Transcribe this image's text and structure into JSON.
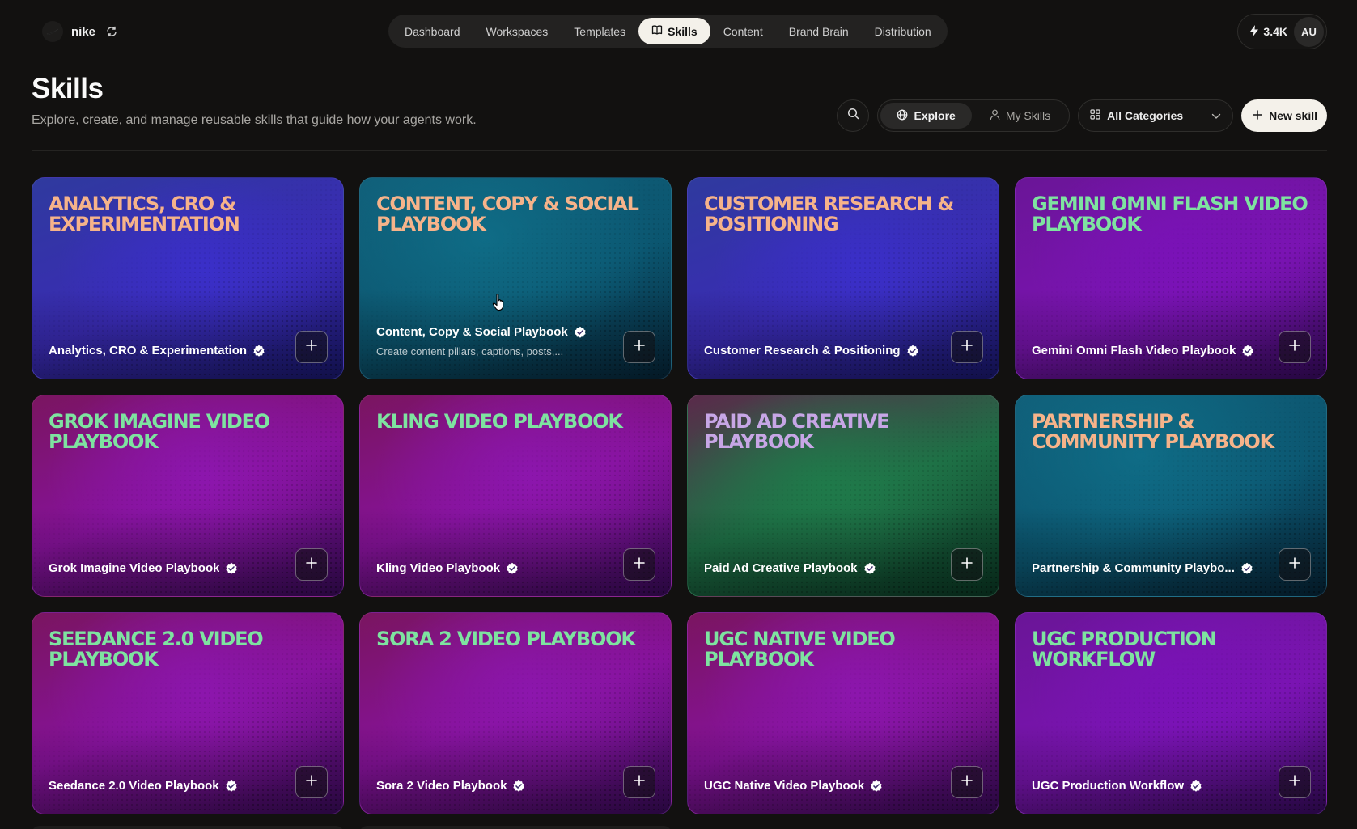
{
  "workspace": {
    "name": "nike"
  },
  "nav": {
    "items": [
      {
        "label": "Dashboard",
        "active": false
      },
      {
        "label": "Workspaces",
        "active": false
      },
      {
        "label": "Templates",
        "active": false
      },
      {
        "label": "Skills",
        "active": true
      },
      {
        "label": "Content",
        "active": false
      },
      {
        "label": "Brand Brain",
        "active": false
      },
      {
        "label": "Distribution",
        "active": false
      }
    ]
  },
  "account": {
    "credits": "3.4K",
    "initials": "AU"
  },
  "header": {
    "title": "Skills",
    "subtitle": "Explore, create, and manage reusable skills that guide how your agents work."
  },
  "controls": {
    "tabs": [
      {
        "label": "Explore",
        "icon": "globe-icon",
        "active": true
      },
      {
        "label": "My Skills",
        "icon": "user-icon",
        "active": false
      }
    ],
    "category_label": "All Categories",
    "new_skill_label": "New skill"
  },
  "colors": {
    "title_peach": "#f6b38a",
    "title_mint": "#7ee3a0",
    "title_lavender": "#c7a6e6",
    "accent_light": "#f4f1ea"
  },
  "skills": [
    {
      "title": "ANALYTICS, CRO & EXPERIMENTATION",
      "name": "Analytics, CRO & Experimentation",
      "description": "",
      "verified": true
    },
    {
      "title": "CONTENT, COPY & SOCIAL PLAYBOOK",
      "name": "Content, Copy & Social Playbook",
      "description": "Create content pillars, captions, posts,...",
      "verified": true
    },
    {
      "title": "CUSTOMER RESEARCH & POSITIONING",
      "name": "Customer Research & Positioning",
      "description": "",
      "verified": true
    },
    {
      "title": "GEMINI OMNI FLASH VIDEO PLAYBOOK",
      "name": "Gemini Omni Flash Video Playbook",
      "description": "",
      "verified": true
    },
    {
      "title": "GROK IMAGINE VIDEO PLAYBOOK",
      "name": "Grok Imagine Video Playbook",
      "description": "",
      "verified": true
    },
    {
      "title": "KLING VIDEO PLAYBOOK",
      "name": "Kling Video Playbook",
      "description": "",
      "verified": true
    },
    {
      "title": "PAID AD CREATIVE PLAYBOOK",
      "name": "Paid Ad Creative Playbook",
      "description": "",
      "verified": true
    },
    {
      "title": "PARTNERSHIP & COMMUNITY PLAYBOOK",
      "name": "Partnership & Community Playbo...",
      "description": "",
      "verified": true
    },
    {
      "title": "SEEDANCE 2.0 VIDEO PLAYBOOK",
      "name": "Seedance 2.0 Video Playbook",
      "description": "",
      "verified": true
    },
    {
      "title": "SORA 2 VIDEO PLAYBOOK",
      "name": "Sora 2 Video Playbook",
      "description": "",
      "verified": true
    },
    {
      "title": "UGC NATIVE VIDEO PLAYBOOK",
      "name": "UGC Native Video Playbook",
      "description": "",
      "verified": true
    },
    {
      "title": "UGC PRODUCTION WORKFLOW",
      "name": "UGC Production Workflow",
      "description": "",
      "verified": true
    }
  ]
}
